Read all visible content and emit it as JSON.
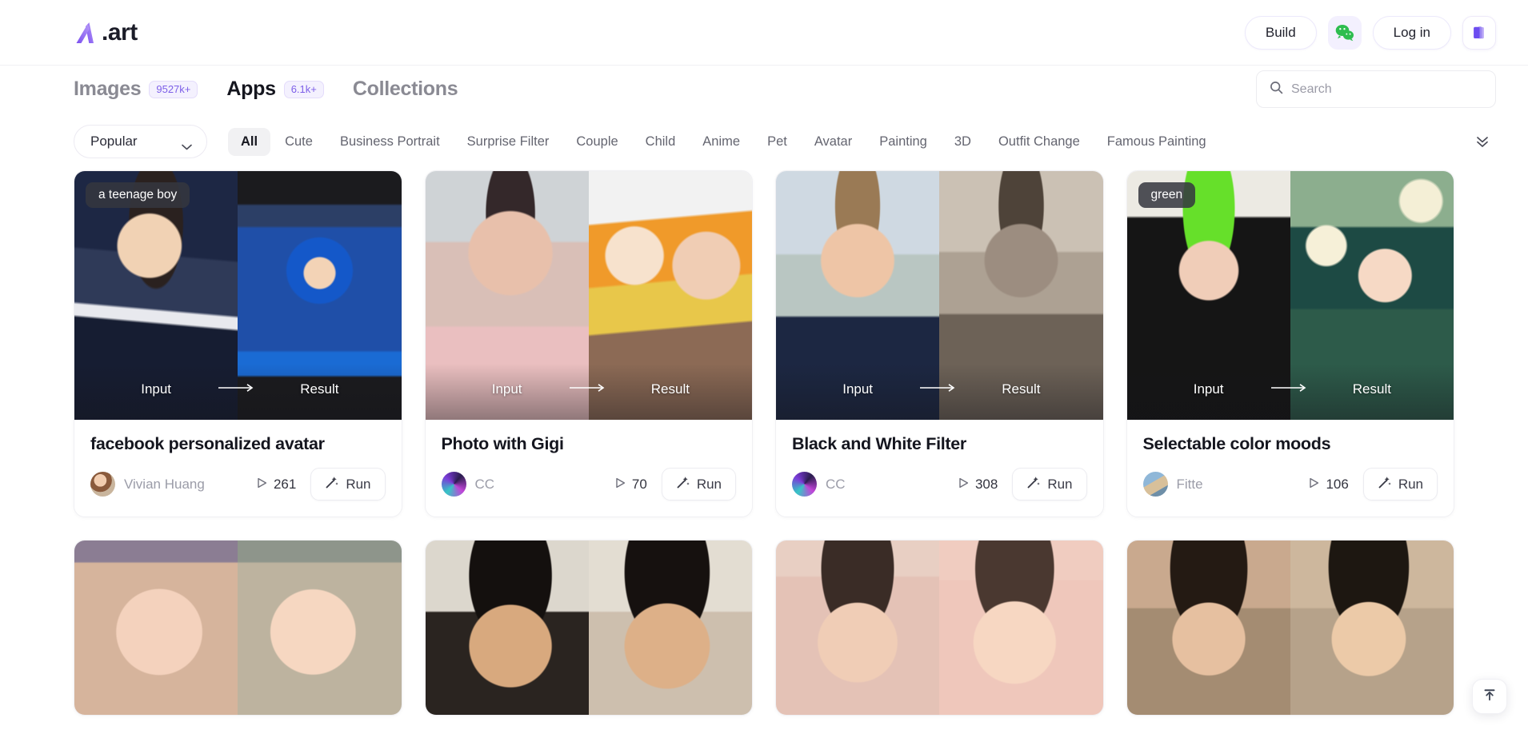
{
  "brand": {
    "name": ".art",
    "logo_icon": "a-art-logo-icon",
    "accent": "#7b5cf0"
  },
  "topbar": {
    "build_label": "Build",
    "login_label": "Log in",
    "wechat_icon": "wechat-icon",
    "library_icon": "library-books-icon"
  },
  "nav": {
    "tabs": [
      {
        "label": "Images",
        "badge": "9527k+",
        "active": false
      },
      {
        "label": "Apps",
        "badge": "6.1k+",
        "active": true
      },
      {
        "label": "Collections",
        "badge": "",
        "active": false
      }
    ]
  },
  "search": {
    "placeholder": "Search",
    "value": "",
    "icon": "search-icon"
  },
  "filters": {
    "sort_label": "Popular",
    "sort_icon": "chevron-down-icon",
    "expand_icon": "double-chevron-down-icon",
    "categories": [
      {
        "label": "All",
        "active": true
      },
      {
        "label": "Cute",
        "active": false
      },
      {
        "label": "Business Portrait",
        "active": false
      },
      {
        "label": "Surprise Filter",
        "active": false
      },
      {
        "label": "Couple",
        "active": false
      },
      {
        "label": "Child",
        "active": false
      },
      {
        "label": "Anime",
        "active": false
      },
      {
        "label": "Pet",
        "active": false
      },
      {
        "label": "Avatar",
        "active": false
      },
      {
        "label": "Painting",
        "active": false
      },
      {
        "label": "3D",
        "active": false
      },
      {
        "label": "Outfit Change",
        "active": false
      },
      {
        "label": "Famous Painting",
        "active": false
      }
    ]
  },
  "grid": {
    "input_label": "Input",
    "result_label": "Result",
    "run_label": "Run",
    "run_icon": "magic-wand-icon",
    "runs_icon": "play-count-icon",
    "cards": [
      {
        "title": "facebook personalized avatar",
        "author": "Vivian Huang",
        "runs": "261",
        "prompt_tag": "a teenage boy"
      },
      {
        "title": "Photo with Gigi",
        "author": "CC",
        "runs": "70",
        "prompt_tag": ""
      },
      {
        "title": "Black and White Filter",
        "author": "CC",
        "runs": "308",
        "prompt_tag": ""
      },
      {
        "title": "Selectable color moods",
        "author": "Fitte",
        "runs": "106",
        "prompt_tag": "green"
      }
    ]
  },
  "floating": {
    "to_top_icon": "scroll-to-top-icon"
  }
}
